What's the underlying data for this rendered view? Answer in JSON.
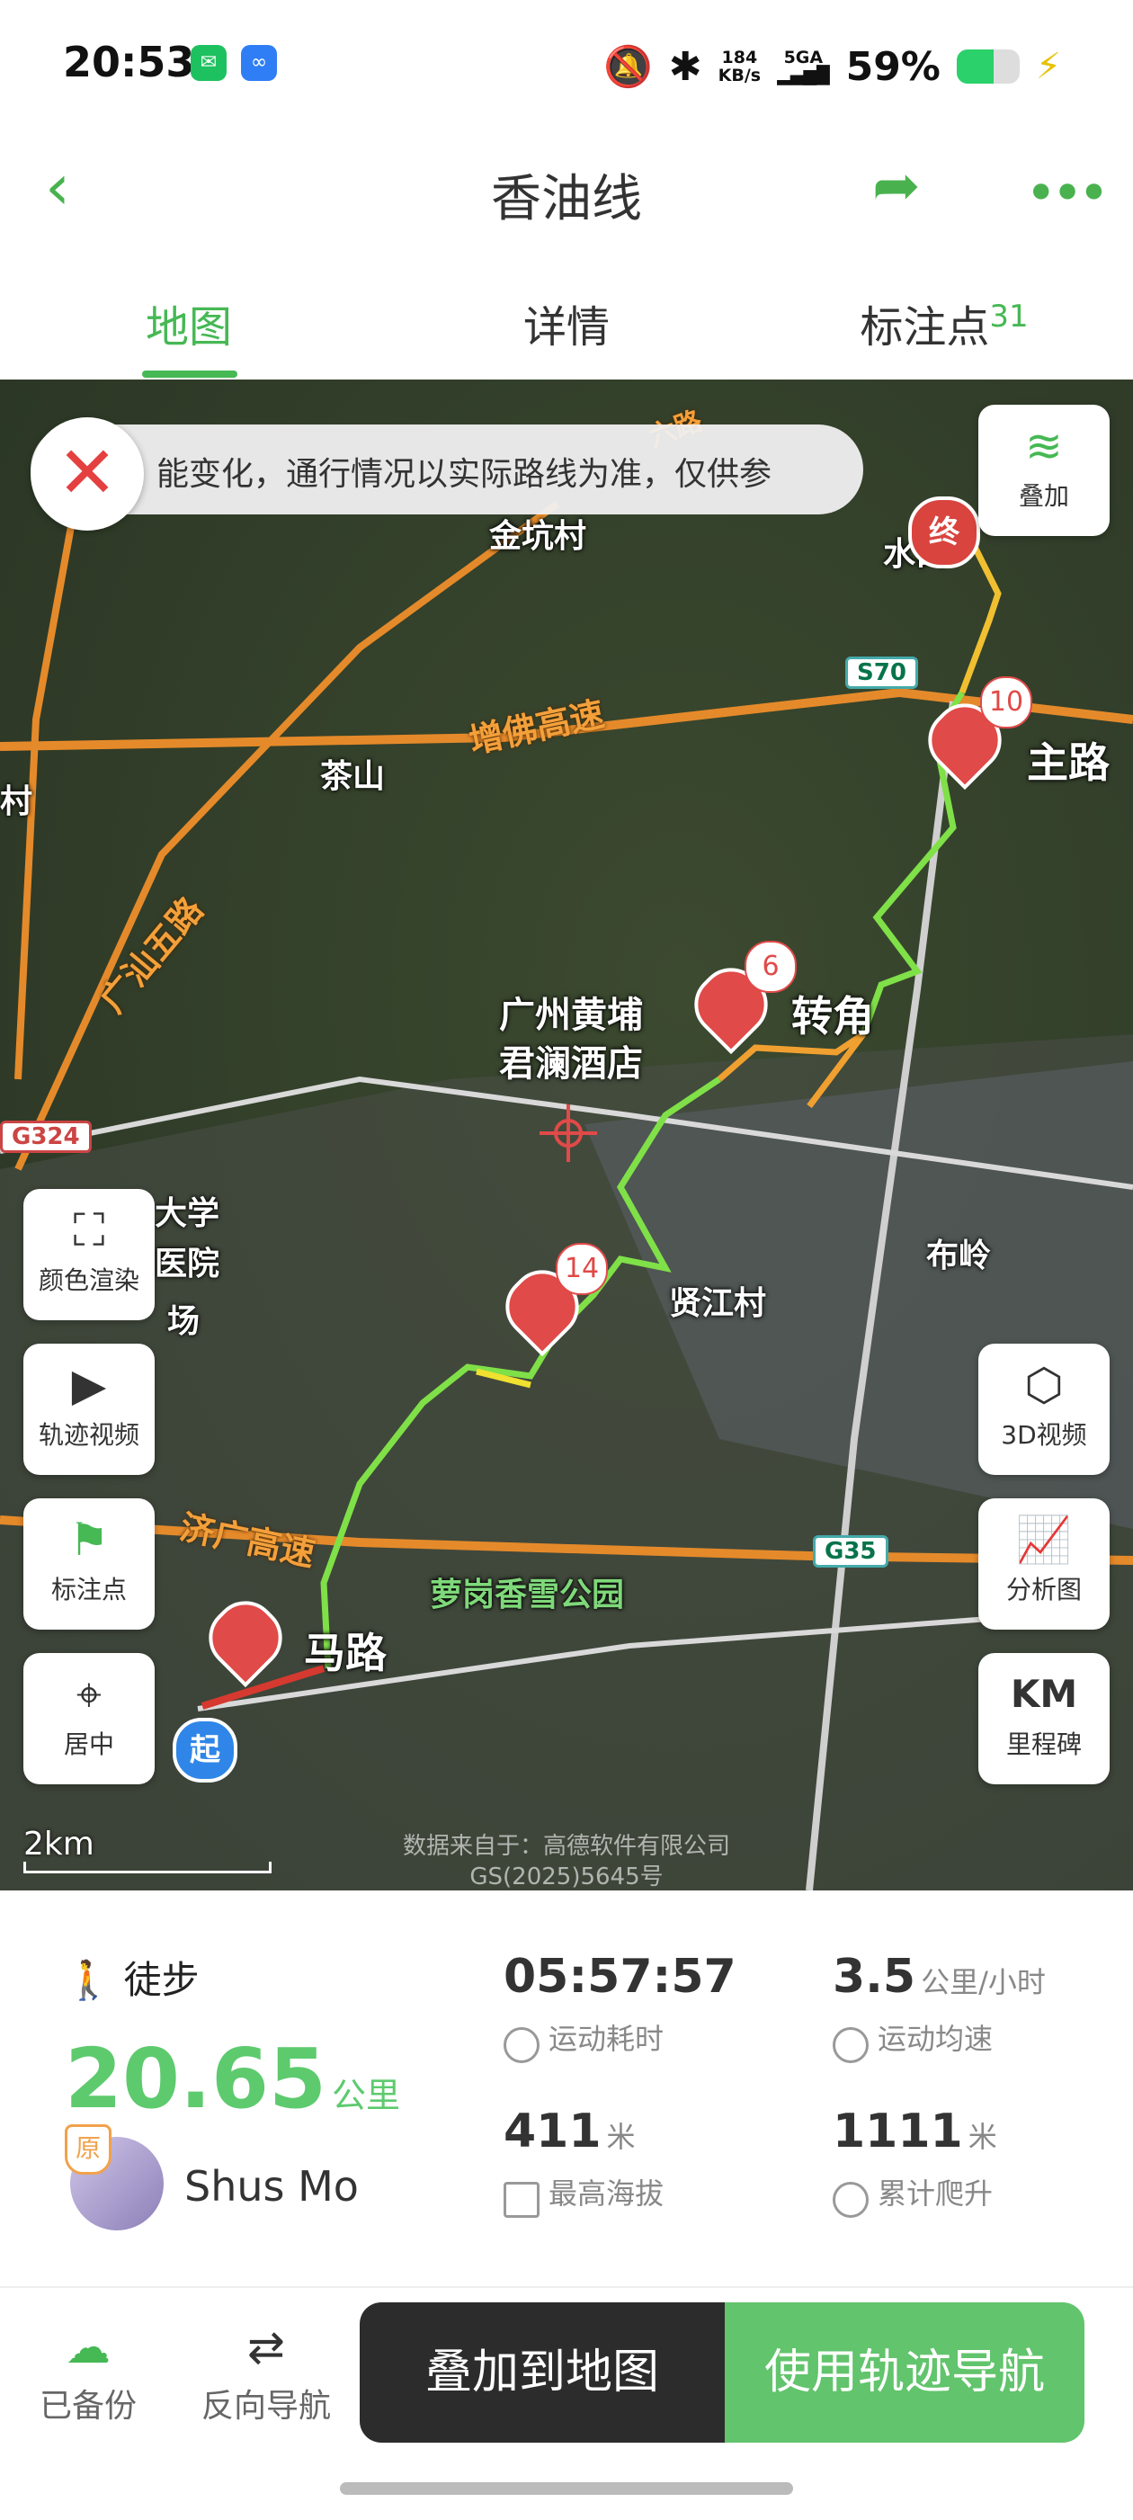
{
  "status_bar": {
    "time": "20:53",
    "net_speed": "184",
    "net_unit": "KB/s",
    "signal": "5GA",
    "battery": "59%",
    "battery_level": 0.59,
    "icons": [
      "wechat-icon",
      "dingtalk-icon",
      "mute-icon",
      "bluetooth-icon",
      "signal-icon",
      "battery-icon",
      "charging-icon"
    ]
  },
  "header": {
    "title": "香油线",
    "back_icon": "chevron-left-icon",
    "share_icon": "share-arrow-icon",
    "more_icon": "more-dots-icon"
  },
  "tabs": [
    {
      "label": "地图",
      "active": true
    },
    {
      "label": "详情",
      "active": false
    },
    {
      "label": "标注点",
      "count": "31",
      "active": false
    }
  ],
  "map": {
    "notice": "能变化，通行情况以实际路线为准，仅供参",
    "labels": {
      "jinkeng": "金坑村",
      "shui": "水口",
      "chashan": "茶山",
      "zhulu": "主路",
      "hotel": "广州黄埔\n君澜酒店",
      "zhuanjiao": "转角",
      "university": "大学",
      "hospital": "医院",
      "chang": "场",
      "xianjiang": "贤江村",
      "buling": "布岭",
      "park": "萝岗香雪公园",
      "malu": "马路",
      "shi": "村"
    },
    "roads": {
      "zengfo": "增佛高速",
      "guangshan": "广汕五路",
      "jiguang": "济广高速",
      "s70": "S70",
      "g35": "G35",
      "g324": "G324",
      "top_road": "六路"
    },
    "pins": [
      {
        "number": "10"
      },
      {
        "number": "6"
      },
      {
        "number": "14"
      }
    ],
    "end_label": "终",
    "start_label": "起",
    "scale": "2km",
    "credit_line1": "数据来自于：高德软件有限公司",
    "credit_line2": "GS(2025)5645号",
    "buttons": {
      "overlay": "叠加",
      "color_render": "颜色渲染",
      "track_video": "轨迹视频",
      "marker": "标注点",
      "center": "居中",
      "video3d": "3D视频",
      "analysis": "分析图",
      "km_big": "KM",
      "milestone": "里程碑"
    }
  },
  "stats": {
    "sport": "徒步",
    "distance": "20.65",
    "distance_unit": "公里",
    "badge": "原",
    "username": "Shus Mo",
    "duration": "05:57:57",
    "duration_label": "运动耗时",
    "avg_speed": "3.5",
    "avg_speed_unit": "公里/小时",
    "avg_speed_label": "运动均速",
    "max_alt": "411",
    "max_alt_unit": "米",
    "max_alt_label": "最高海拔",
    "climb": "1111",
    "climb_unit": "米",
    "climb_label": "累计爬升"
  },
  "bottom": {
    "backup": "已备份",
    "reverse": "反向导航",
    "overlay_btn": "叠加到地图",
    "nav_btn": "使用轨迹导航"
  }
}
